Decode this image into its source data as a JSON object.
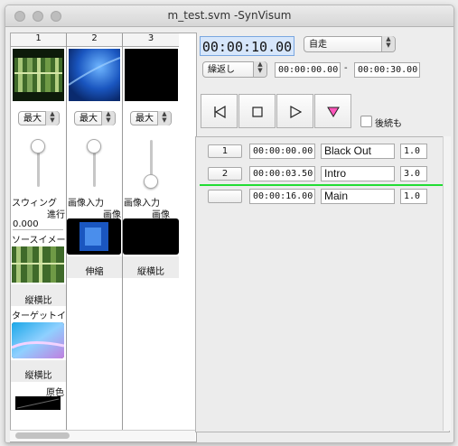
{
  "window": {
    "title": "m_test.svm -SynVisum"
  },
  "channels": [
    {
      "number": "1",
      "size_select": "最大",
      "slider_level": 0.1,
      "effect_label": "スウィング",
      "sub_label": "進行",
      "value": "0.000"
    },
    {
      "number": "2",
      "size_select": "最大",
      "slider_level": 0.1,
      "effect_label": "画像入力",
      "sub_label": "画像",
      "mode_label": "伸縮"
    },
    {
      "number": "3",
      "size_select": "最大",
      "slider_level": 1.0,
      "effect_label": "画像入力",
      "sub_label": "画像",
      "mode_label": "縦横比"
    }
  ],
  "channel1_extra": {
    "source_label": "ソースイメー",
    "aspect1": "縦横比",
    "target_label": "ターゲットイ",
    "aspect2": "縦横比",
    "orig_label": "原色"
  },
  "transport": {
    "time": "00:00:10.00",
    "mode_select": "自走",
    "repeat_select": "繰返し",
    "range_start": "00:00:00.00",
    "range_sep": "-",
    "range_end": "00:00:30.00",
    "continue_label": "後続も",
    "continue_checked": false
  },
  "cues": [
    {
      "num": "1",
      "time": "00:00:00.00",
      "name": "Black Out",
      "dur": "1.0"
    },
    {
      "num": "2",
      "time": "00:00:03.50",
      "name": "Intro",
      "dur": "3.0"
    },
    {
      "num": "",
      "time": "00:00:16.00",
      "name": "Main",
      "dur": "1.0"
    }
  ],
  "colors": {
    "playhead": "#22dd33",
    "marker": "#ff55bb"
  },
  "icons": [
    "rewind-icon",
    "stop-icon",
    "play-icon",
    "marker-icon",
    "chevron-updown-icon"
  ]
}
